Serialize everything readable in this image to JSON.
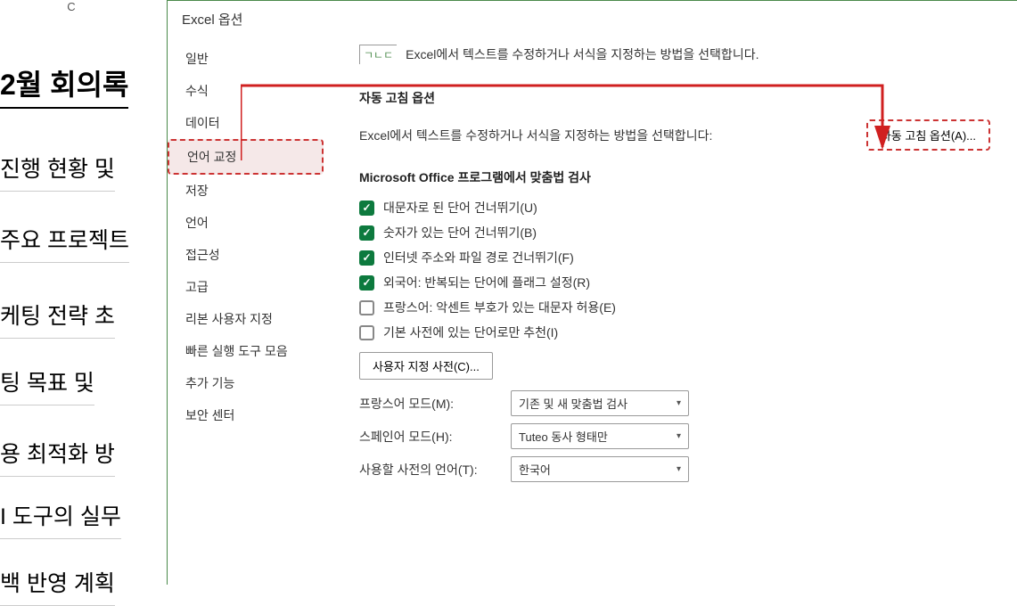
{
  "spreadsheet": {
    "col_header": "C",
    "title": "2월 회의록",
    "rows": [
      "진행 현황 및",
      "주요 프로젝트",
      "케팅 전략 초",
      "팅 목표 및",
      "용 최적화 방",
      "I 도구의 실무",
      "백 반영 계획"
    ]
  },
  "dialog": {
    "title": "Excel 옵션",
    "nav": [
      "일반",
      "수식",
      "데이터",
      "언어 교정",
      "저장",
      "언어",
      "접근성",
      "고급",
      "리본 사용자 지정",
      "빠른 실행 도구 모음",
      "추가 기능",
      "보안 센터"
    ],
    "nav_selected_index": 3,
    "intro": "Excel에서 텍스트를 수정하거나 서식을 지정하는 방법을 선택합니다.",
    "intro_icon": "ㄱㄴㄷ",
    "section_autocorrect": "자동 고침 옵션",
    "desc": "Excel에서 텍스트를 수정하거나 서식을 지정하는 방법을 선택합니다:",
    "btn_autocorrect": "자동 고침 옵션(A)...",
    "section_spelling": "Microsoft Office 프로그램에서 맞춤법 검사",
    "checks": [
      {
        "label": "대문자로 된 단어 건너뛰기(U)",
        "checked": true
      },
      {
        "label": "숫자가 있는 단어 건너뛰기(B)",
        "checked": true
      },
      {
        "label": "인터넷 주소와 파일 경로 건너뛰기(F)",
        "checked": true
      },
      {
        "label": "외국어: 반복되는 단어에 플래그 설정(R)",
        "checked": true
      },
      {
        "label": "프랑스어: 악센트 부호가 있는 대문자 허용(E)",
        "checked": false
      },
      {
        "label": "기본 사전에 있는 단어로만 추천(I)",
        "checked": false
      }
    ],
    "btn_dict": "사용자 지정 사전(C)...",
    "fields": {
      "french_label": "프랑스어 모드(M):",
      "french_val": "기존 및 새 맞춤법 검사",
      "spanish_label": "스페인어 모드(H):",
      "spanish_val": "Tuteo 동사 형태만",
      "dict_lang_label": "사용할 사전의 언어(T):",
      "dict_lang_val": "한국어"
    }
  }
}
